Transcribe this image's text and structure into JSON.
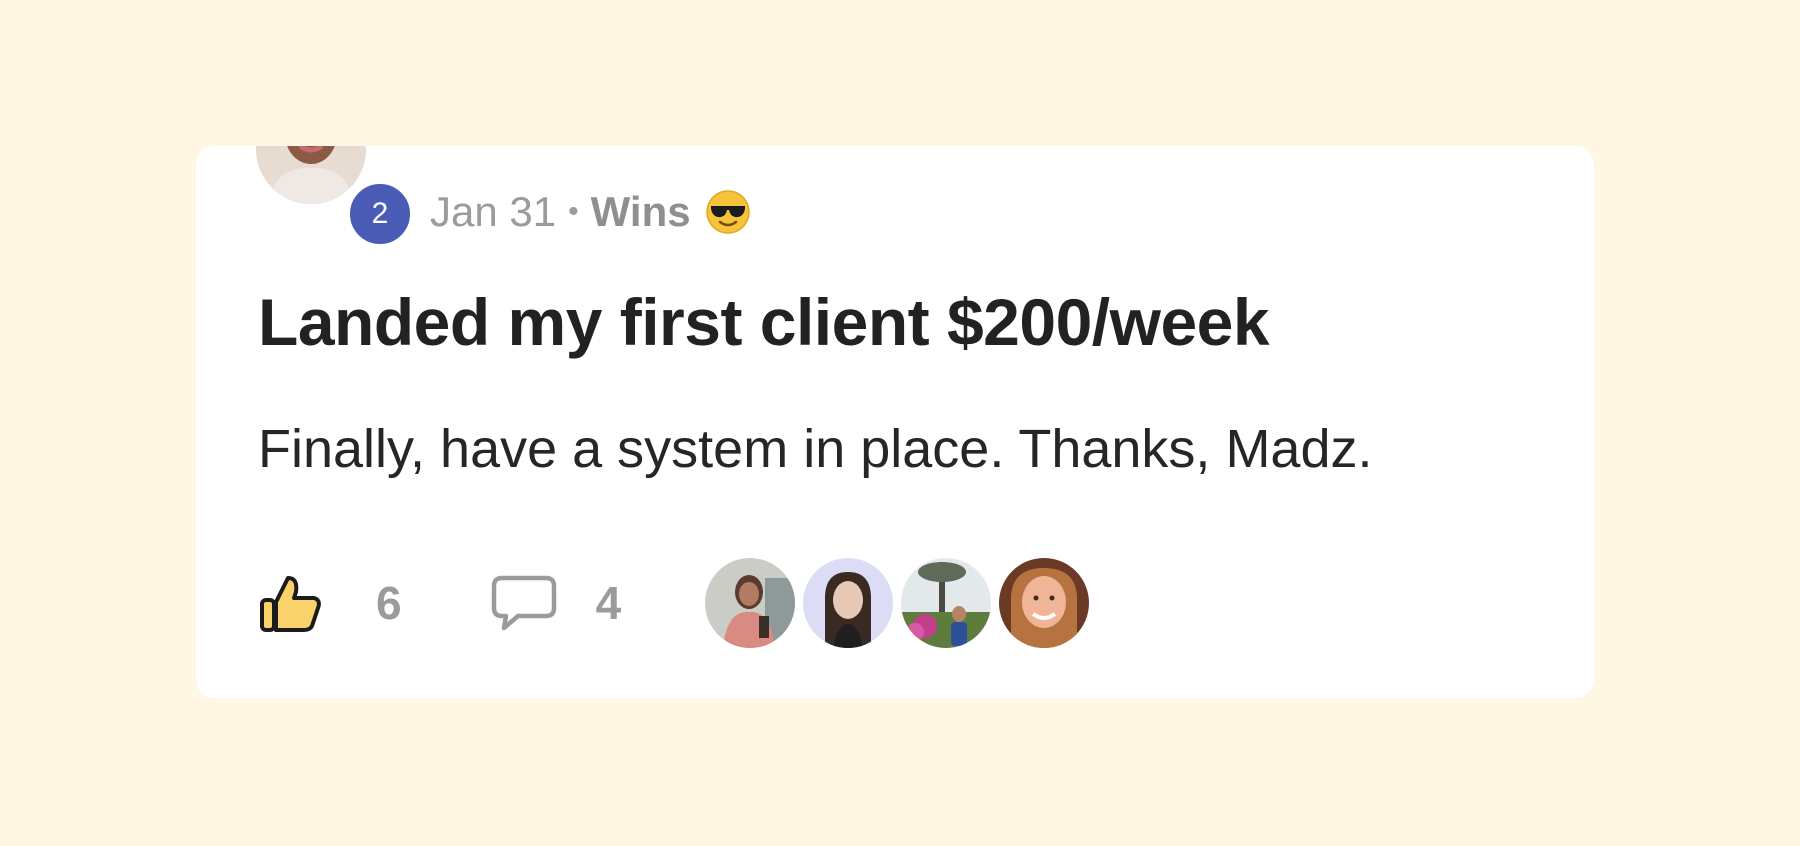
{
  "post": {
    "author": {
      "avatar_icon": "author-avatar-photo",
      "level": "2",
      "level_color": "#4a5cb5"
    },
    "date": "Jan 31",
    "separator": "•",
    "category": "Wins",
    "category_emoji_icon": "sunglasses-emoji-icon",
    "title": "Landed my first client $200/week",
    "body": "Finally, have a system in place. Thanks, Madz.",
    "actions": {
      "like_icon": "thumbs-up-icon",
      "like_count": "6",
      "comment_icon": "comment-bubble-icon",
      "comment_count": "4"
    },
    "likers": [
      {
        "avatar_icon": "liker-avatar-1"
      },
      {
        "avatar_icon": "liker-avatar-2"
      },
      {
        "avatar_icon": "liker-avatar-3"
      },
      {
        "avatar_icon": "liker-avatar-4"
      }
    ]
  },
  "colors": {
    "page_background": "#fdf7e4",
    "card_background": "#ffffff",
    "title_text": "#222222",
    "muted_text": "#9b9b9b",
    "like_fill": "#f9d26b"
  }
}
